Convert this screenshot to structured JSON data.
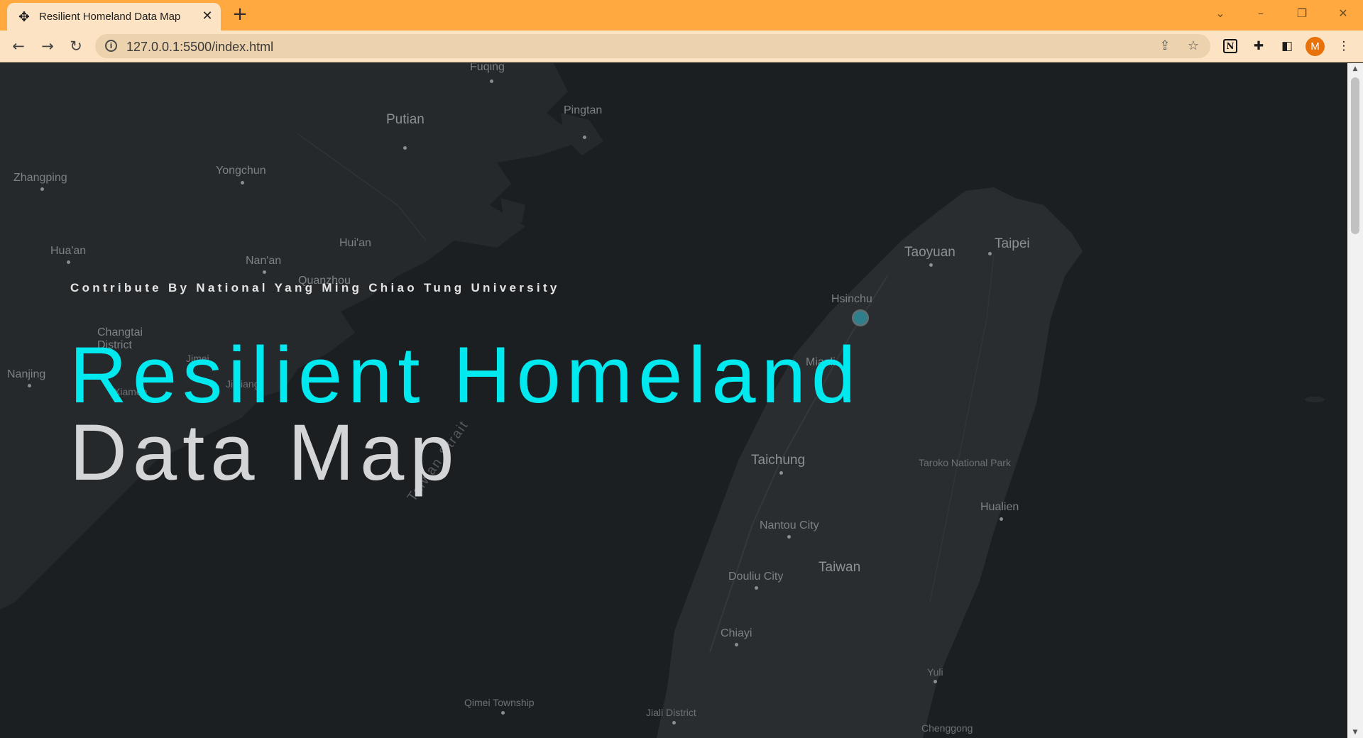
{
  "browser": {
    "tab_title": "Resilient Homeland Data Map",
    "tab_icon": "drone-icon",
    "new_tab_symbol": "+",
    "url": "127.0.0.1:5500/index.html",
    "profile_initial": "M",
    "accent_color": "#ffa940",
    "extension_notion_letter": "N"
  },
  "map": {
    "places": {
      "fuqing": "Fuqing",
      "putian": "Putian",
      "pingtan": "Pingtan",
      "zhangping": "Zhangping",
      "yongchun": "Yongchun",
      "huaan": "Hua'an",
      "huian": "Hui'an",
      "nanan": "Nan'an",
      "quanzhou": "Quanzhou",
      "changtai": "Changtai\nDistrict",
      "nanjing": "Nanjing",
      "jimei": "Jimei",
      "jinjiang": "Jinjiang",
      "xiamen": "Xiamen",
      "taiwan_strait": "Taiwan Strait",
      "taoyuan": "Taoyuan",
      "taipei": "Taipei",
      "hsinchu": "Hsinchu",
      "miaoli": "Miaoli",
      "taichung": "Taichung",
      "taroko": "Taroko National Park",
      "hualien": "Hualien",
      "nantou": "Nantou City",
      "douliu": "Douliu City",
      "taiwan": "Taiwan",
      "chiayi": "Chiayi",
      "yuli": "Yuli",
      "qimei": "Qimei Township",
      "jiali": "Jiali District",
      "chenggong": "Chenggong"
    },
    "marker_color": "#2e7f8c"
  },
  "hero": {
    "subtitle": "Contribute By National Yang Ming Chiao Tung University",
    "title_line1": "Resilient Homeland",
    "title_line2": "Data Map",
    "title_line1_color": "#00e9ee",
    "title_line2_color": "#d4d5d6"
  }
}
